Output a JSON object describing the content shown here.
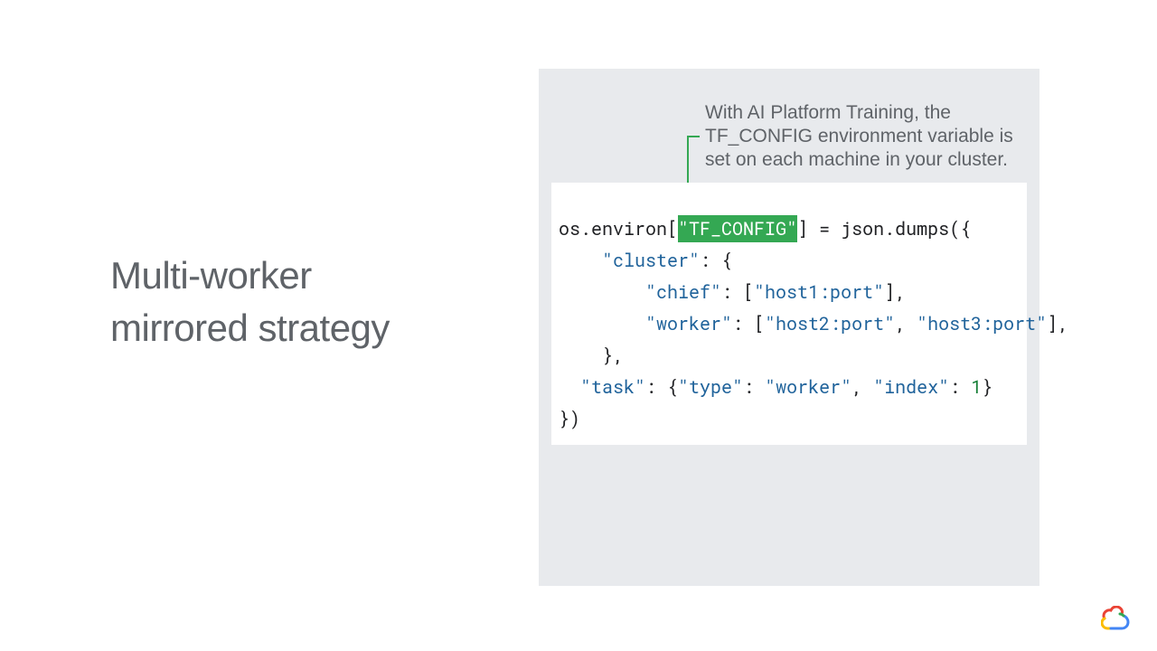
{
  "title": {
    "line1": "Multi-worker",
    "line2": "mirrored strategy"
  },
  "annotation": "With AI Platform Training, the TF_CONFIG environment variable is set on each machine in your cluster.",
  "code": {
    "env_access": "os.environ[",
    "tf_config_key": "\"TF_CONFIG\"",
    "after_key": "] = json.dumps({",
    "cluster_key": "\"cluster\"",
    "open_brace": ": {",
    "chief_key": "\"chief\"",
    "chief_list_open": ": [",
    "chief_host": "\"host1:port\"",
    "close_bracket_comma": "],",
    "worker_key": "\"worker\"",
    "worker_list_open": ": [",
    "worker_host1": "\"host2:port\"",
    "comma_sp": ", ",
    "worker_host2": "\"host3:port\"",
    "cluster_close": "    },",
    "task_key": "\"task\"",
    "task_open": ": {",
    "type_key": "\"type\"",
    "type_colon": ": ",
    "type_val": "\"worker\"",
    "index_key": "\"index\"",
    "index_colon": ": ",
    "index_val": "1",
    "task_close": "}",
    "final_close": "})"
  }
}
